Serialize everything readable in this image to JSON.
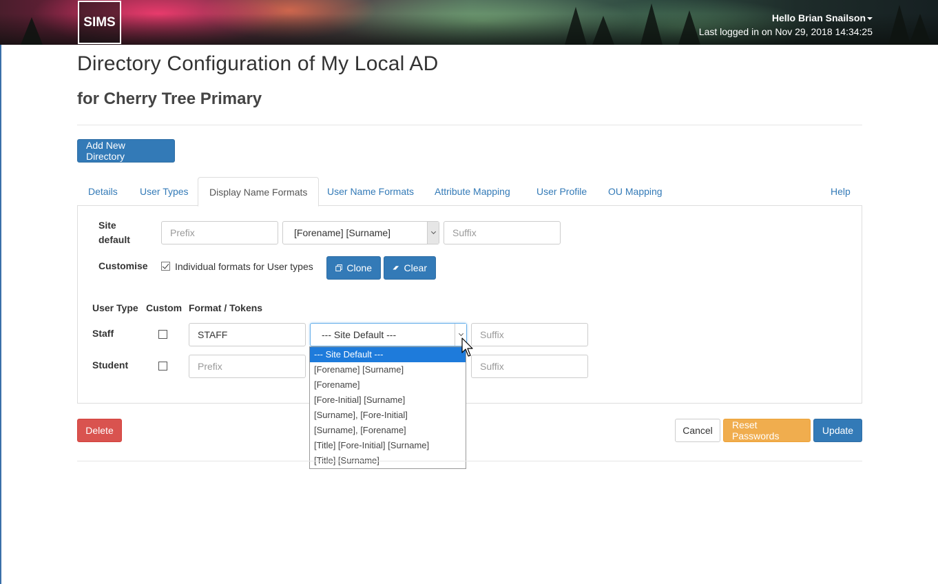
{
  "header": {
    "logo_text": "SIMS",
    "greeting": "Hello Brian Snailson",
    "last_login": "Last logged in on Nov 29, 2018 14:34:25"
  },
  "page": {
    "title": "Directory Configuration of My Local AD",
    "subtitle": "for Cherry Tree Primary"
  },
  "add_directory_label": "Add New Directory",
  "tabs": [
    {
      "label": "Details"
    },
    {
      "label": "User Types"
    },
    {
      "label": "Display Name Formats"
    },
    {
      "label": "User Name Formats"
    },
    {
      "label": "Attribute Mapping"
    },
    {
      "label": "User Profile"
    },
    {
      "label": "OU Mapping"
    },
    {
      "label": "Help"
    }
  ],
  "active_tab": "Display Name Formats",
  "site_default": {
    "label_line1": "Site",
    "label_line2": "default",
    "prefix_placeholder": "Prefix",
    "format_value": "[Forename] [Surname]",
    "suffix_placeholder": "Suffix"
  },
  "customise": {
    "label": "Customise",
    "checkbox_label": "Individual formats for User types",
    "checked": true,
    "clone_label": "Clone",
    "clear_label": "Clear"
  },
  "table": {
    "headers": [
      "User Type",
      "Custom",
      "Format / Tokens"
    ],
    "rows": [
      {
        "user_type": "Staff",
        "custom": false,
        "prefix": "STAFF",
        "format": "--- Site Default ---",
        "suffix_placeholder": "Suffix"
      },
      {
        "user_type": "Student",
        "custom": false,
        "prefix_placeholder": "Prefix",
        "suffix_placeholder": "Suffix"
      }
    ]
  },
  "dropdown_options": [
    "--- Site Default ---",
    "[Forename] [Surname]",
    "[Forename]",
    "[Fore-Initial] [Surname]",
    "[Surname], [Fore-Initial]",
    "[Surname], [Forename]",
    "[Title] [Fore-Initial] [Surname]",
    "[Title] [Surname]"
  ],
  "dropdown_selected_index": 0,
  "actions": {
    "delete_label": "Delete",
    "cancel_label": "Cancel",
    "reset_label": "Reset Passwords",
    "update_label": "Update"
  },
  "colors": {
    "primary": "#337ab7",
    "danger": "#d9534f",
    "warning": "#f0ad4e",
    "dropdown_highlight": "#1e7bdb"
  }
}
